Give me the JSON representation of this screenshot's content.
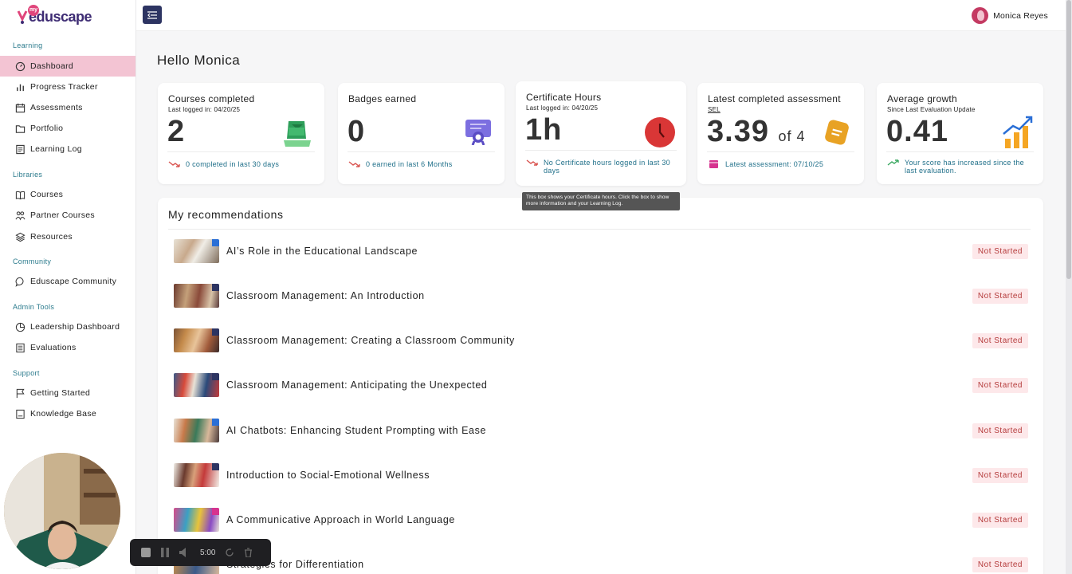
{
  "brand": {
    "logo_text": "eduscape",
    "logo_badge": "my"
  },
  "user": {
    "name": "Monica Reyes"
  },
  "greeting": "Hello Monica",
  "sidebar": {
    "sections": [
      {
        "label": "Learning",
        "items": [
          {
            "label": "Dashboard",
            "icon": "gauge-icon",
            "active": true
          },
          {
            "label": "Progress Tracker",
            "icon": "bar-chart-icon"
          },
          {
            "label": "Assessments",
            "icon": "calendar-icon"
          },
          {
            "label": "Portfolio",
            "icon": "folder-icon"
          },
          {
            "label": "Learning Log",
            "icon": "log-icon"
          }
        ]
      },
      {
        "label": "Libraries",
        "items": [
          {
            "label": "Courses",
            "icon": "book-icon"
          },
          {
            "label": "Partner Courses",
            "icon": "people-icon"
          },
          {
            "label": "Resources",
            "icon": "layers-icon"
          }
        ]
      },
      {
        "label": "Community",
        "items": [
          {
            "label": "Eduscape Community",
            "icon": "chat-icon"
          }
        ]
      },
      {
        "label": "Admin Tools",
        "items": [
          {
            "label": "Leadership Dashboard",
            "icon": "pie-chart-icon"
          },
          {
            "label": "Evaluations",
            "icon": "list-icon"
          }
        ]
      },
      {
        "label": "Support",
        "items": [
          {
            "label": "Getting Started",
            "icon": "flag-icon"
          },
          {
            "label": "Knowledge Base",
            "icon": "notebook-icon"
          }
        ]
      }
    ]
  },
  "cards": {
    "courses": {
      "title": "Courses completed",
      "sub": "Last logged in: 04/20/25",
      "value": "2",
      "foot": "0 completed in last 30 days"
    },
    "badges": {
      "title": "Badges earned",
      "value": "0",
      "foot": "0 earned in last 6 Months"
    },
    "certificate": {
      "title": "Certificate Hours",
      "sub": "Last logged in: 04/20/25",
      "value": "1h",
      "foot": "No Certificate hours logged in last 30 days"
    },
    "assessment": {
      "title": "Latest completed assessment",
      "sub": "SEL",
      "value": "3.39",
      "of": "of 4",
      "foot": "Latest assessment: 07/10/25"
    },
    "growth": {
      "title": "Average growth",
      "sub": "Since Last Evaluation Update",
      "value": "0.41",
      "foot": "Your score has increased since the last evaluation."
    }
  },
  "tooltip": "This box shows your Certificate hours. Click the box to show more information and your Learning Log.",
  "recommendations": {
    "heading": "My recommendations",
    "items": [
      {
        "title": "AI’s Role in the Educational Landscape",
        "status": "Not Started"
      },
      {
        "title": "Classroom Management: An Introduction",
        "status": "Not Started"
      },
      {
        "title": "Classroom Management: Creating a Classroom Community",
        "status": "Not Started"
      },
      {
        "title": "Classroom Management: Anticipating the Unexpected",
        "status": "Not Started"
      },
      {
        "title": "AI Chatbots: Enhancing Student Prompting with Ease",
        "status": "Not Started"
      },
      {
        "title": "Introduction to Social-Emotional Wellness",
        "status": "Not Started"
      },
      {
        "title": "A Communicative Approach in World Language",
        "status": "Not Started"
      },
      {
        "title": "Strategies for Differentiation",
        "status": "Not Started"
      }
    ]
  },
  "recorder": {
    "time": "5:00"
  },
  "colors": {
    "active_nav": "#f3c4d3",
    "accent": "#2d3462",
    "status_bg": "#fde8ea",
    "status_text": "#b43a3a",
    "link": "#1f6f89"
  }
}
